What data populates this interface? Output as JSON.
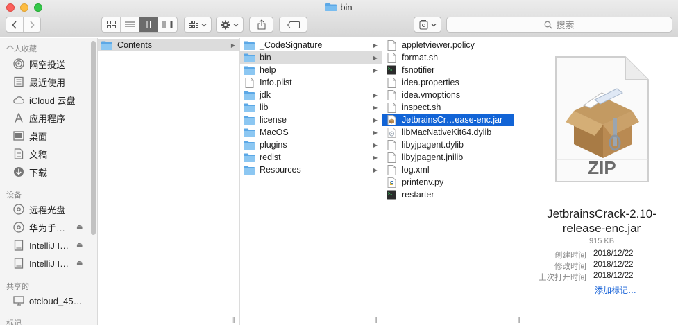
{
  "window": {
    "title": "bin",
    "search_placeholder": "搜索"
  },
  "sidebar": {
    "sections": [
      {
        "header": "个人收藏",
        "items": [
          {
            "label": "隔空投送",
            "icon": "airdrop-icon"
          },
          {
            "label": "最近使用",
            "icon": "recents-icon"
          },
          {
            "label": "iCloud 云盘",
            "icon": "cloud-icon"
          },
          {
            "label": "应用程序",
            "icon": "applications-icon"
          },
          {
            "label": "桌面",
            "icon": "desktop-icon"
          },
          {
            "label": "文稿",
            "icon": "documents-icon"
          },
          {
            "label": "下载",
            "icon": "downloads-icon"
          }
        ]
      },
      {
        "header": "设备",
        "items": [
          {
            "label": "远程光盘",
            "icon": "disc-icon",
            "eject": false
          },
          {
            "label": "华为手…",
            "icon": "disc-icon",
            "eject": true
          },
          {
            "label": "IntelliJ I…",
            "icon": "drive-icon",
            "eject": true
          },
          {
            "label": "IntelliJ I…",
            "icon": "drive-icon",
            "eject": true
          }
        ]
      },
      {
        "header": "共享的",
        "items": [
          {
            "label": "otcloud_45…",
            "icon": "computer-icon"
          }
        ]
      },
      {
        "header": "标记",
        "items": []
      }
    ]
  },
  "columns": {
    "col1": [
      {
        "name": "Contents",
        "type": "folder",
        "arrow": true,
        "selected": false
      }
    ],
    "col2": [
      {
        "name": "_CodeSignature",
        "type": "folder",
        "arrow": true
      },
      {
        "name": "bin",
        "type": "folder",
        "arrow": true,
        "highlight": true
      },
      {
        "name": "help",
        "type": "folder",
        "arrow": true
      },
      {
        "name": "Info.plist",
        "type": "doc",
        "arrow": false
      },
      {
        "name": "jdk",
        "type": "folder",
        "arrow": true
      },
      {
        "name": "lib",
        "type": "folder",
        "arrow": true
      },
      {
        "name": "license",
        "type": "folder",
        "arrow": true
      },
      {
        "name": "MacOS",
        "type": "folder",
        "arrow": true
      },
      {
        "name": "plugins",
        "type": "folder",
        "arrow": true
      },
      {
        "name": "redist",
        "type": "folder",
        "arrow": true
      },
      {
        "name": "Resources",
        "type": "folder",
        "arrow": true
      }
    ],
    "col3": [
      {
        "name": "appletviewer.policy",
        "type": "doc"
      },
      {
        "name": "format.sh",
        "type": "doc"
      },
      {
        "name": "fsnotifier",
        "type": "exec"
      },
      {
        "name": "idea.properties",
        "type": "doc"
      },
      {
        "name": "idea.vmoptions",
        "type": "doc"
      },
      {
        "name": "inspect.sh",
        "type": "doc"
      },
      {
        "name": "JetbrainsCr…ease-enc.jar",
        "type": "jar",
        "selected": true
      },
      {
        "name": "libMacNativeKit64.dylib",
        "type": "dylib"
      },
      {
        "name": "libyjpagent.dylib",
        "type": "doc"
      },
      {
        "name": "libyjpagent.jnilib",
        "type": "doc"
      },
      {
        "name": "log.xml",
        "type": "doc"
      },
      {
        "name": "printenv.py",
        "type": "py"
      },
      {
        "name": "restarter",
        "type": "exec"
      }
    ]
  },
  "preview": {
    "icon_label": "ZIP",
    "name_line1": "JetbrainsCrack-2.10-",
    "name_line2": "release-enc.jar",
    "size": "915 KB",
    "created_label": "创建时间",
    "created_value": "2018/12/22",
    "modified_label": "修改时间",
    "modified_value": "2018/12/22",
    "opened_label": "上次打开时间",
    "opened_value": "2018/12/22",
    "add_tags": "添加标记…"
  },
  "colors": {
    "selection": "#1264d6",
    "folder": "#5ca8e6",
    "link": "#1a64d8"
  }
}
